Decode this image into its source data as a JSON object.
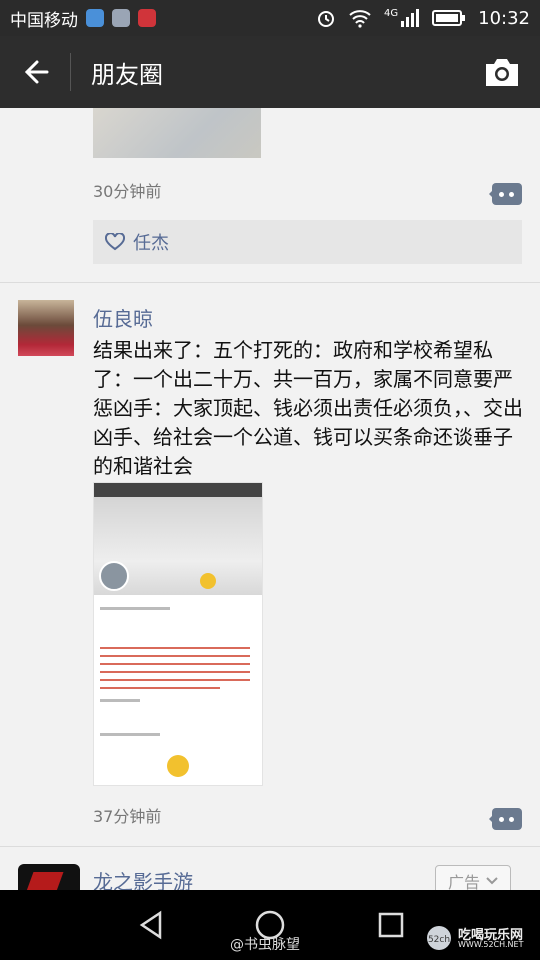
{
  "statusbar": {
    "carrier": "中国移动",
    "network": "4G",
    "time": "10:32"
  },
  "header": {
    "title": "朋友圈"
  },
  "feed": {
    "post1": {
      "time": "30分钟前",
      "likes": [
        "任杰"
      ]
    },
    "post2": {
      "author": "伍良晾",
      "text": "结果出来了：五个打死的：政府和学校希望私了：一个出二十万、共一百万，家属不同意要严惩凶手：大家顶起、钱必须出责任必须负，、交出凶手、给社会一个公道、钱可以买条命还谈垂子的和谐社会",
      "time": "37分钟前"
    },
    "ad": {
      "name": "龙之影手游",
      "tag": "广告"
    }
  },
  "watermark": {
    "text": "@书虫脉望",
    "site_name": "吃喝玩乐网",
    "site_url": "WWW.52CH.NET"
  }
}
